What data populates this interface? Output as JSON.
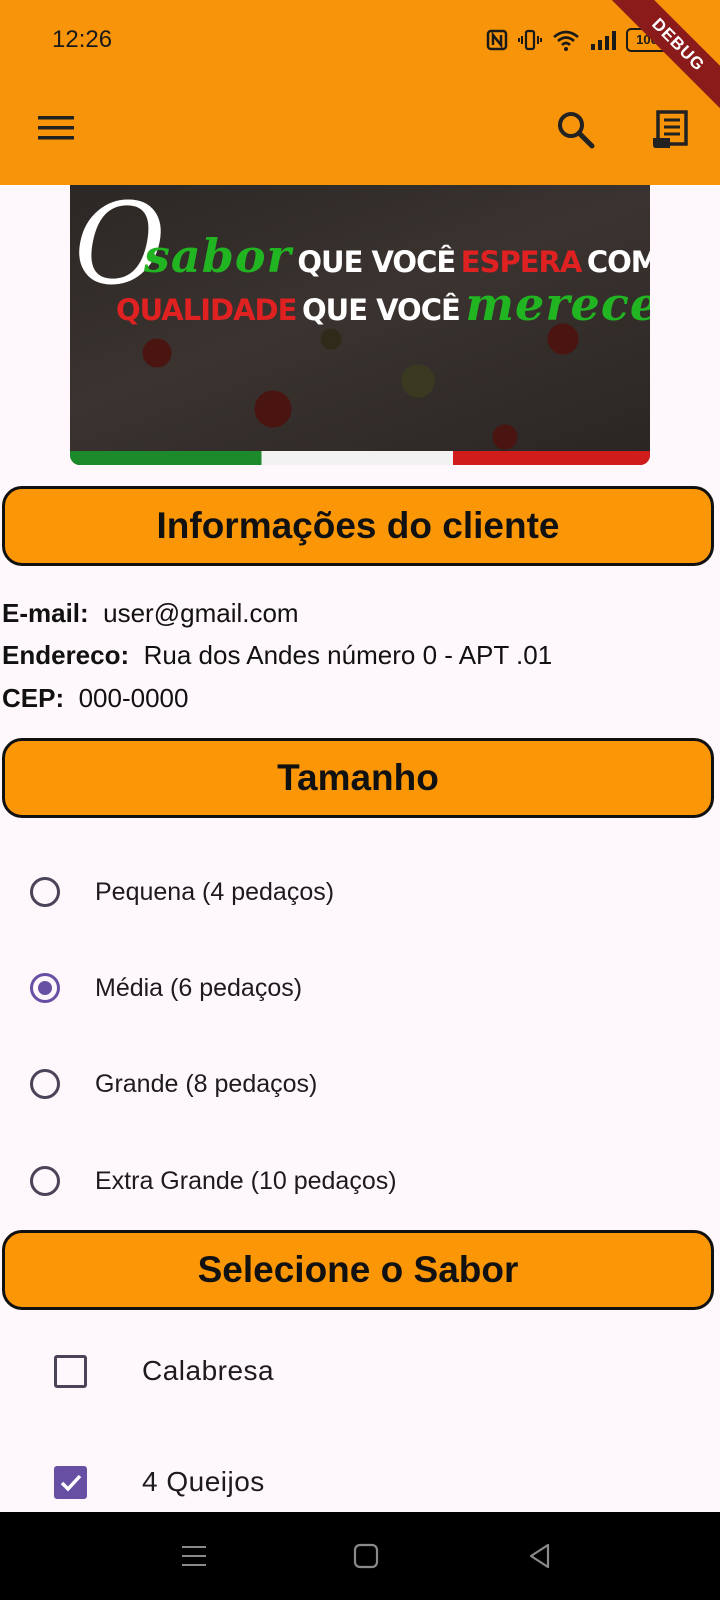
{
  "status_bar": {
    "time": "12:26",
    "battery": "100",
    "debug_ribbon": "DEBUG"
  },
  "app_bar": {
    "menu_icon": "menu-icon",
    "search_icon": "search-icon",
    "receipt_icon": "receipt-icon",
    "background_color": "#f7940a"
  },
  "banner": {
    "big_letter": "O",
    "line1": {
      "word1": "sabor",
      "word2": "QUE VOCÊ",
      "word3": "ESPERA",
      "word4": "COM A"
    },
    "line2": {
      "word1": "QUALIDADE",
      "word2": "QUE VOCÊ",
      "word3": "merece"
    }
  },
  "client_section": {
    "title": "Informações do cliente",
    "email_label": "E-mail:",
    "email_value": "user@gmail.com",
    "address_label": "Endereco:",
    "address_value": "Rua dos Andes número 0 - APT .01",
    "cep_label": "CEP:",
    "cep_value": "000-0000"
  },
  "size_section": {
    "title": "Tamanho",
    "options": [
      {
        "label": "Pequena (4 pedaços)",
        "selected": false
      },
      {
        "label": "Média (6 pedaços)",
        "selected": true
      },
      {
        "label": "Grande (8 pedaços)",
        "selected": false
      },
      {
        "label": "Extra Grande (10 pedaços)",
        "selected": false
      }
    ]
  },
  "flavor_section": {
    "title": "Selecione o Sabor",
    "options": [
      {
        "label": "Calabresa",
        "checked": false
      },
      {
        "label": "4 Queijos",
        "checked": true
      }
    ]
  },
  "colors": {
    "header_orange": "#fb9706",
    "accent_purple": "#6750a4"
  }
}
